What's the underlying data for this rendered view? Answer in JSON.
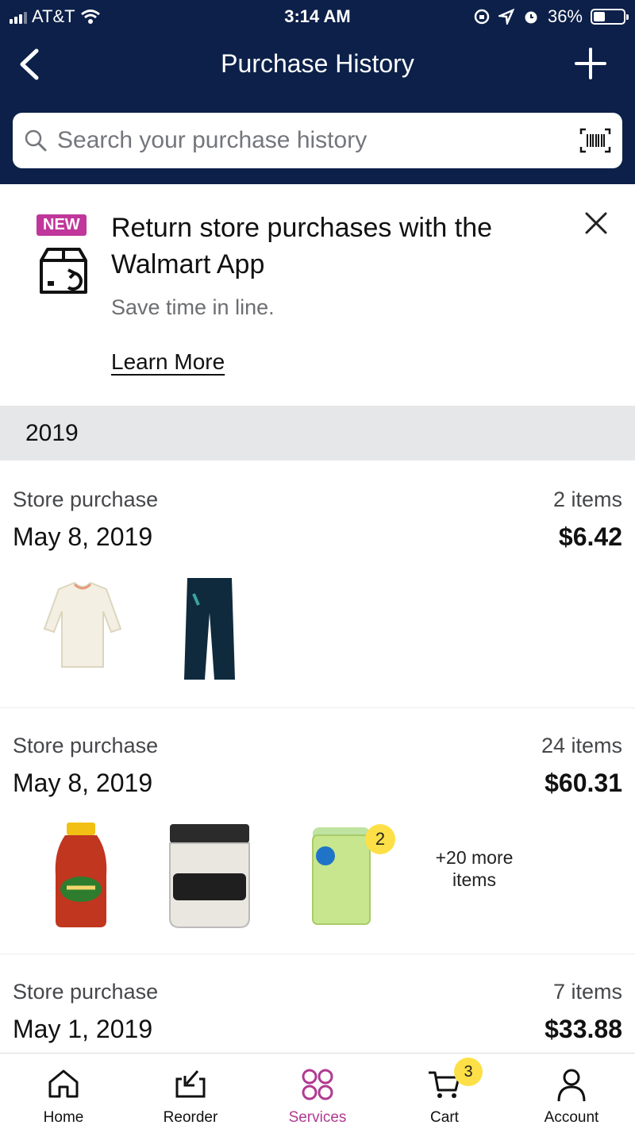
{
  "status_bar": {
    "carrier": "AT&T",
    "time": "3:14 AM",
    "battery": "36%"
  },
  "header": {
    "title": "Purchase History"
  },
  "search": {
    "placeholder": "Search your purchase history"
  },
  "promo": {
    "badge": "NEW",
    "headline": "Return store purchases with the Walmart App",
    "subtitle": "Save time in line.",
    "link": "Learn More"
  },
  "year": "2019",
  "orders": [
    {
      "type": "Store purchase",
      "date": "May 8, 2019",
      "items": "2 items",
      "total": "$6.42"
    },
    {
      "type": "Store purchase",
      "date": "May 8, 2019",
      "items": "24 items",
      "total": "$60.31",
      "more": "+20 more items",
      "qty_badge": "2"
    },
    {
      "type": "Store purchase",
      "date": "May 1, 2019",
      "items": "7 items",
      "total": "$33.88"
    }
  ],
  "tabs": [
    {
      "label": "Home",
      "icon": "home-icon"
    },
    {
      "label": "Reorder",
      "icon": "reorder-icon"
    },
    {
      "label": "Services",
      "icon": "services-icon",
      "active": true
    },
    {
      "label": "Cart",
      "icon": "cart-icon",
      "badge": "3"
    },
    {
      "label": "Account",
      "icon": "account-icon"
    }
  ],
  "colors": {
    "header_bg": "#0c2049",
    "accent": "#c0369b",
    "badge_yellow": "#fde047"
  }
}
